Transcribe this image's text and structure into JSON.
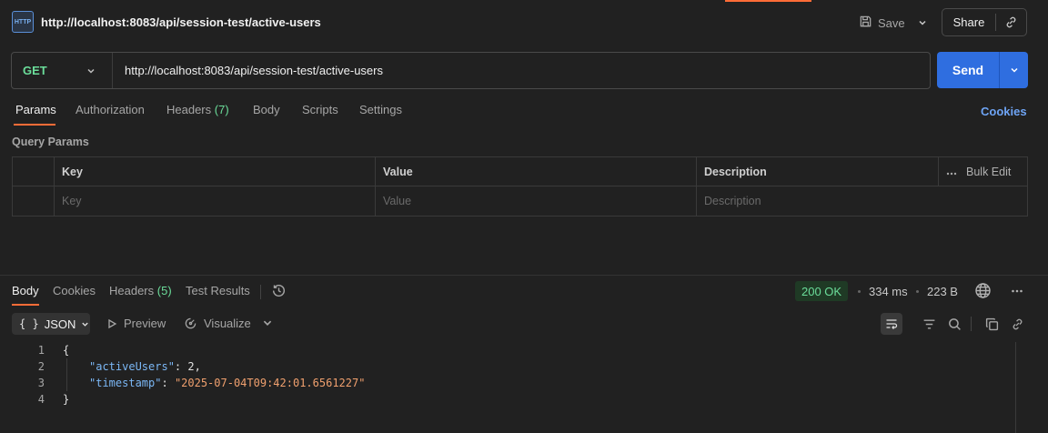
{
  "header": {
    "icon_text": "HTTP",
    "title": "http://localhost:8083/api/session-test/active-users",
    "save_label": "Save",
    "share_label": "Share"
  },
  "request": {
    "method": "GET",
    "url": "http://localhost:8083/api/session-test/active-users",
    "send_label": "Send"
  },
  "request_tabs": {
    "params": "Params",
    "authorization": "Authorization",
    "headers": "Headers",
    "headers_count": "(7)",
    "body": "Body",
    "scripts": "Scripts",
    "settings": "Settings",
    "cookies": "Cookies"
  },
  "query_params": {
    "title": "Query Params",
    "columns": [
      "Key",
      "Value",
      "Description"
    ],
    "bulk_edit": "Bulk Edit",
    "placeholders": [
      "Key",
      "Value",
      "Description"
    ]
  },
  "response_tabs": {
    "body": "Body",
    "cookies": "Cookies",
    "headers": "Headers",
    "headers_count": "(5)",
    "test_results": "Test Results"
  },
  "response_meta": {
    "status": "200 OK",
    "time": "334 ms",
    "size": "223 B"
  },
  "response_toolbar": {
    "format": "JSON",
    "preview": "Preview",
    "visualize": "Visualize"
  },
  "code": {
    "line_numbers": [
      "1",
      "2",
      "3",
      "4"
    ],
    "open_brace": "{",
    "key1": "\"activeUsers\"",
    "val1": "2",
    "key2": "\"timestamp\"",
    "val2": "\"2025-07-04T09:42:01.6561227\"",
    "close_brace": "}"
  },
  "colors": {
    "accent": "#ff6c37",
    "send": "#2f6ee0",
    "method_get": "#6bdd9a",
    "json_key": "#7bb7f5",
    "json_string": "#f0a06e"
  }
}
